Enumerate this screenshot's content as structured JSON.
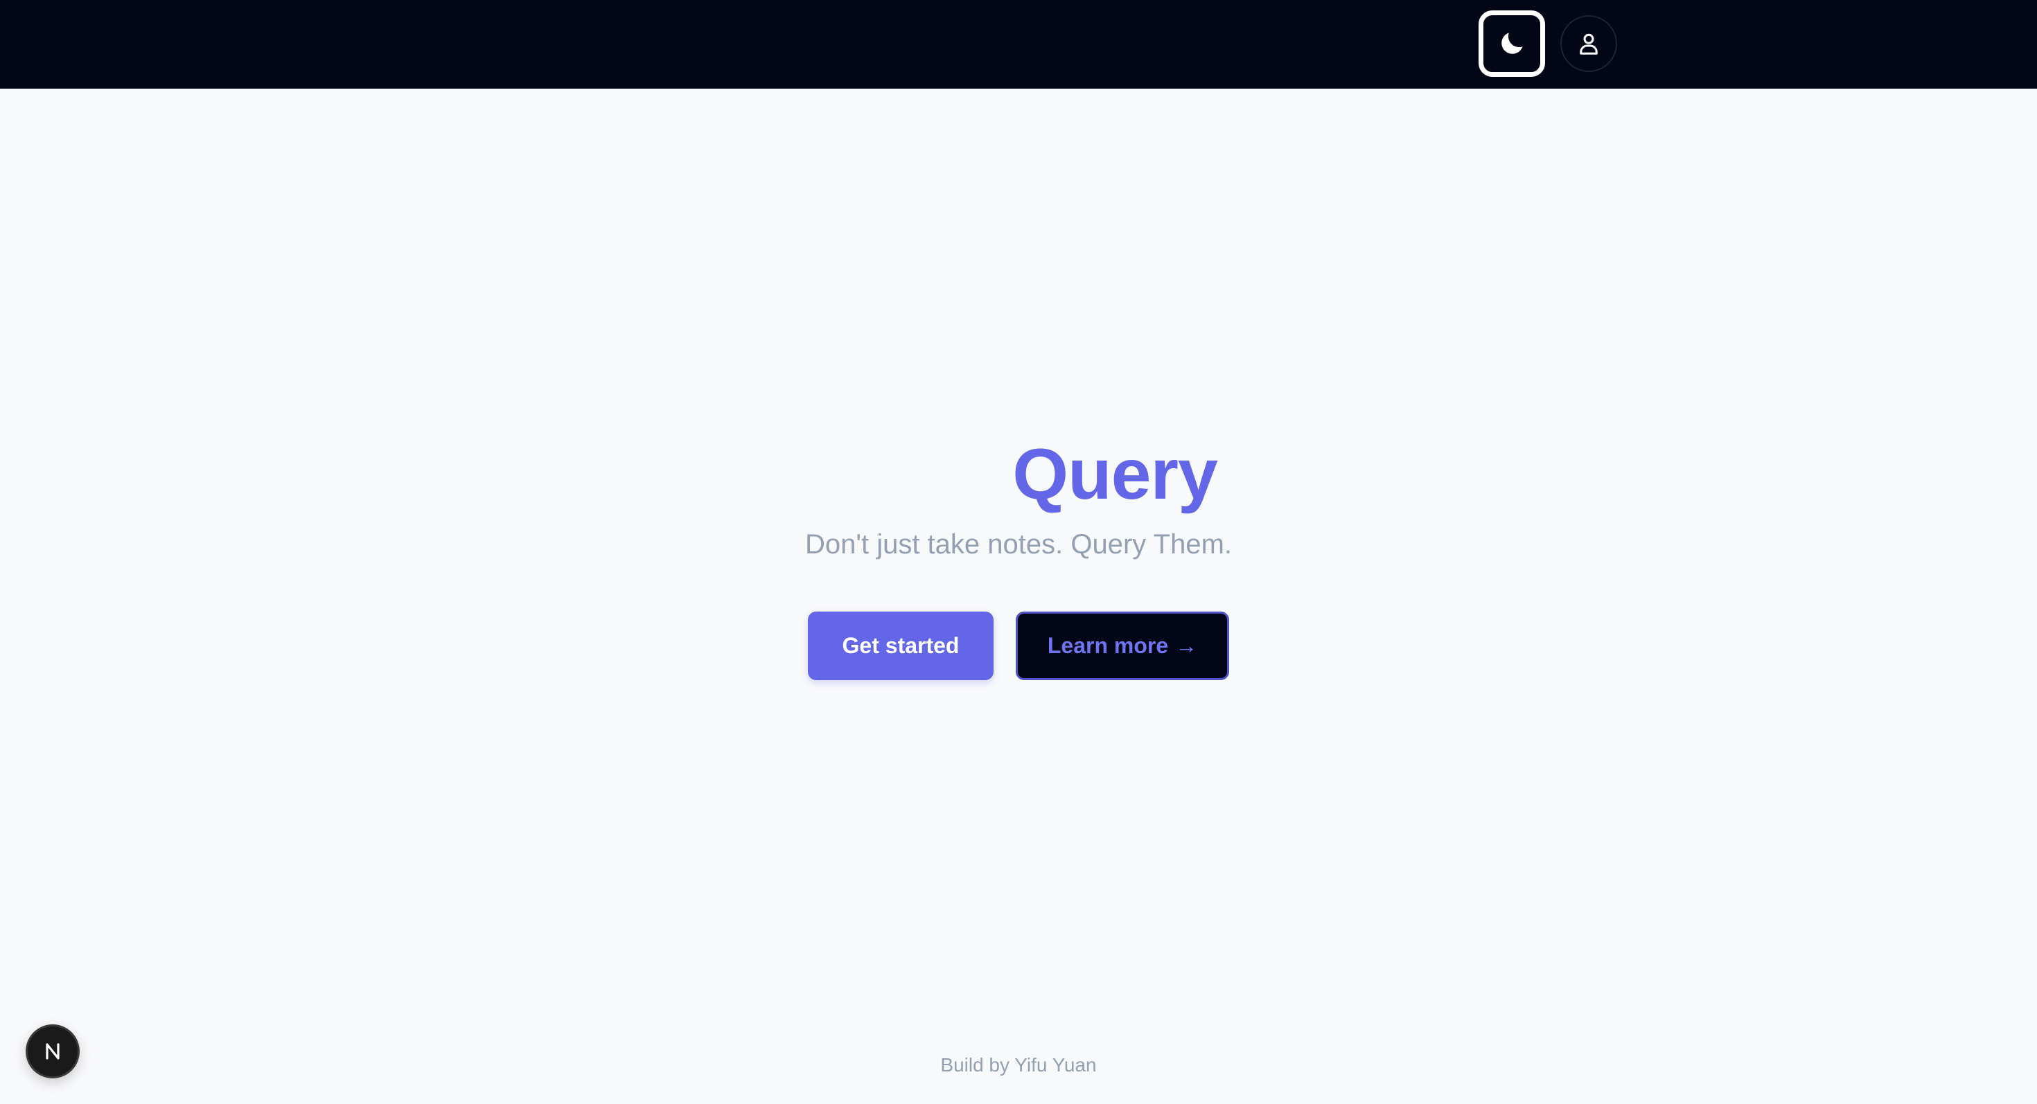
{
  "header": {
    "theme_toggle_icon": "moon-icon",
    "profile_icon": "user-icon"
  },
  "hero": {
    "title": "Query",
    "subtitle": "Don't just take notes. Query Them.",
    "primary_button": "Get started",
    "secondary_button": "Learn more",
    "secondary_arrow": "→"
  },
  "footer": {
    "credit": "Build by Yifu Yuan"
  },
  "badge": {
    "icon": "nextjs-logo-icon"
  },
  "colors": {
    "accent": "#6366e6",
    "header_bg": "#030617",
    "page_bg": "#f8f9fb",
    "muted_text": "#94a0b2"
  }
}
